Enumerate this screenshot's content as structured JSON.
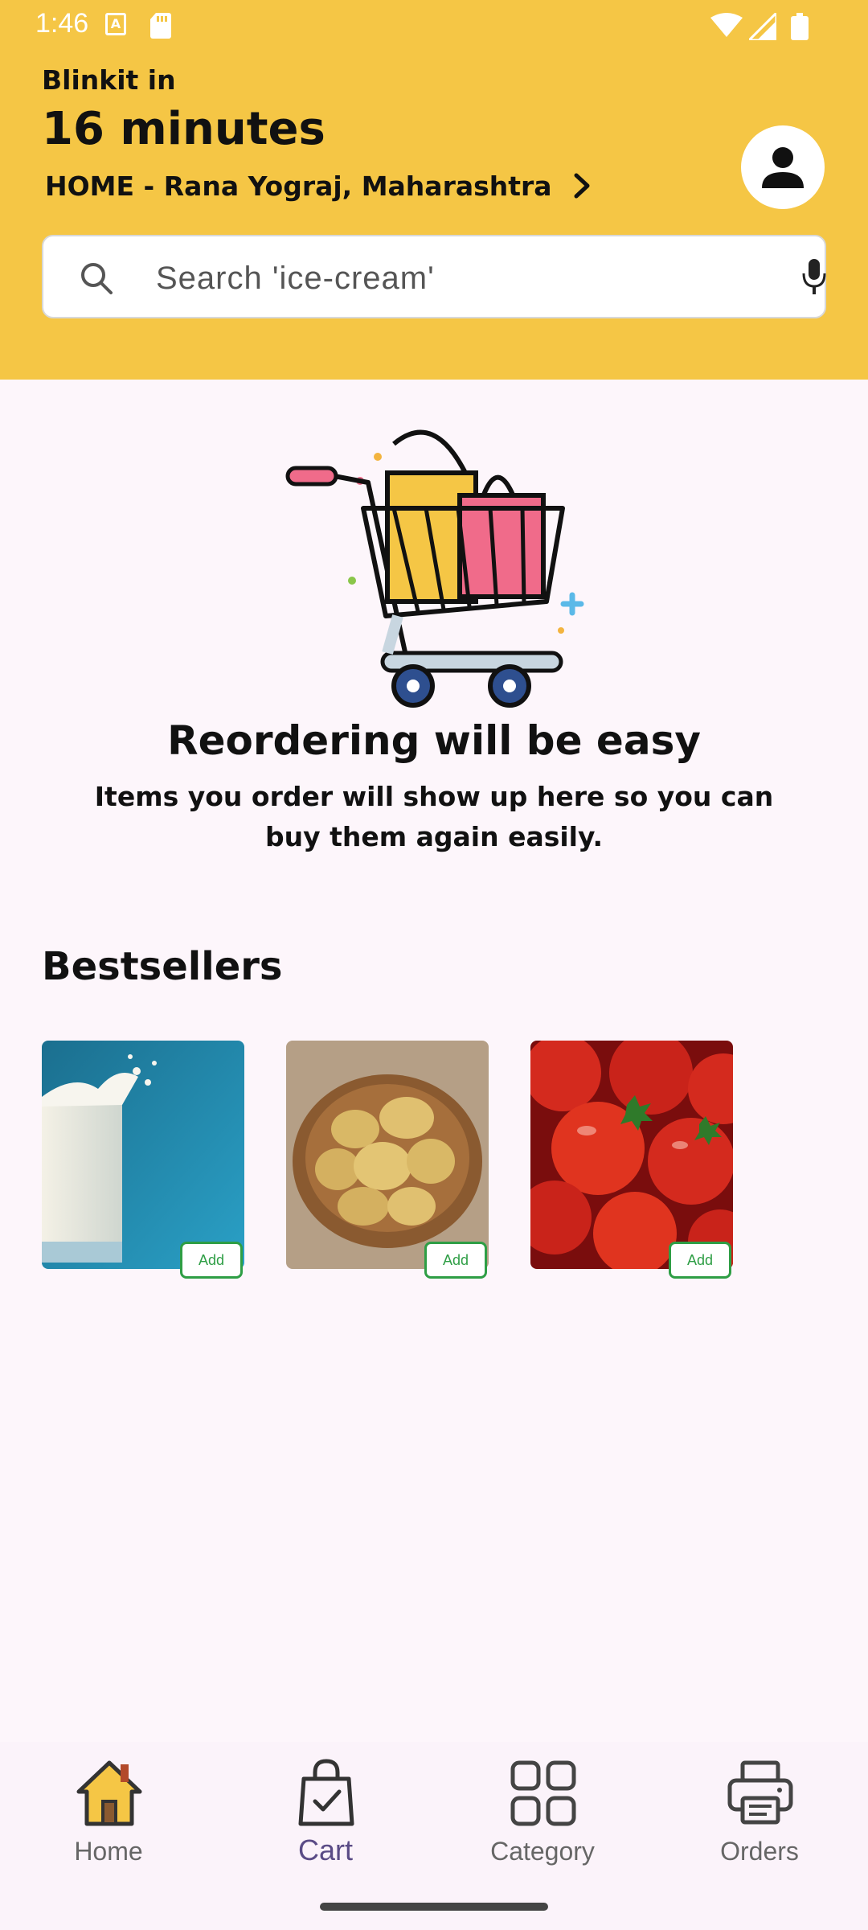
{
  "status_bar": {
    "time": "1:46",
    "a_badge": "A"
  },
  "header": {
    "eta_label": "Blinkit in",
    "eta_value": "16 minutes",
    "address": "HOME - Rana Yograj, Maharashtra",
    "background": "#f5c645"
  },
  "search": {
    "placeholder": "Search 'ice-cream'"
  },
  "empty_state": {
    "title": "Reordering will be easy",
    "subtitle": "Items you order will show up here so you can buy them again easily."
  },
  "bestsellers": {
    "title": "Bestsellers",
    "products": [
      {
        "image": "milk",
        "add_label": "Add"
      },
      {
        "image": "potatoes",
        "add_label": "Add"
      },
      {
        "image": "tomatoes",
        "add_label": "Add"
      }
    ]
  },
  "bottom_nav": {
    "items": [
      {
        "label": "Home",
        "icon": "home-icon"
      },
      {
        "label": "Cart",
        "icon": "cart-icon"
      },
      {
        "label": "Category",
        "icon": "category-icon"
      },
      {
        "label": "Orders",
        "icon": "printer-icon"
      }
    ],
    "active_index": 1
  },
  "colors": {
    "accent": "#2e9e45",
    "active_nav": "#5a4b86"
  }
}
